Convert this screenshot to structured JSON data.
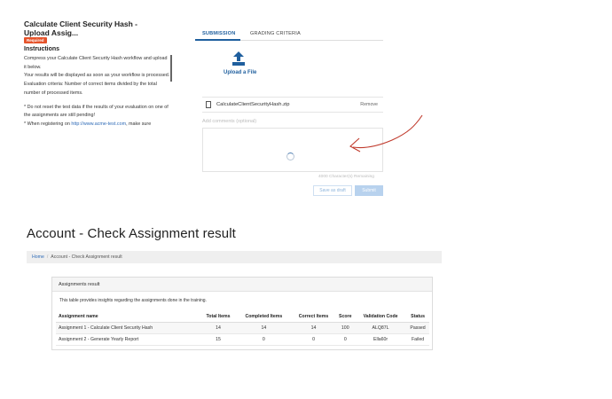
{
  "assignment": {
    "title": "Calculate Client Security Hash - Upload Assig...",
    "badge": "Required",
    "instructions_title": "Instructions",
    "instructions": [
      "Compress your Calculate Client Security Hash workflow and upload it below.",
      "Your results will be displayed as soon as your workflow is processed.",
      "Evaluation criteria: Number of correct items divided by the total number of processed items."
    ],
    "notes": [
      "* Do not reset the test data if the results of your evaluation on one of the assignments are still pending!"
    ],
    "note_register_prefix": "* When registering on ",
    "note_register_link": "http://www.acme-test.com",
    "note_register_suffix": ", make sure"
  },
  "submission": {
    "tabs": [
      {
        "label": "SUBMISSION",
        "active": true
      },
      {
        "label": "GRADING CRITERIA",
        "active": false
      }
    ],
    "upload_label": "Upload a File",
    "upload_icon": "upload-icon",
    "file_name": "CalculateClientSecurityHash.zip",
    "remove_label": "Remove",
    "comments_placeholder": "Add comments (optional)",
    "characters_remaining": "4000 Character(s) Remaining",
    "save_draft_label": "Save as draft",
    "submit_label": "Submit",
    "annotation_color": "#c0392b"
  },
  "account": {
    "page_title": "Account - Check Assignment result",
    "breadcrumb": {
      "home": "Home",
      "separator": "/",
      "current": "Account - Check Assignment result"
    },
    "card_title": "Assignments result",
    "description": "This table provides insights regarding the assignments done in the training.",
    "columns": [
      "Assignment name",
      "Total Items",
      "Completed Items",
      "Correct Items",
      "Score",
      "Validation Code",
      "Status"
    ],
    "rows": [
      [
        "Assignment 1 - Calculate Client Security Hash",
        "14",
        "14",
        "14",
        "100",
        "ALQ87L",
        "Passed"
      ],
      [
        "Assignment 2 - Generate Yearly Report",
        "15",
        "0",
        "0",
        "0",
        "Ella60r",
        "Failed"
      ]
    ]
  }
}
